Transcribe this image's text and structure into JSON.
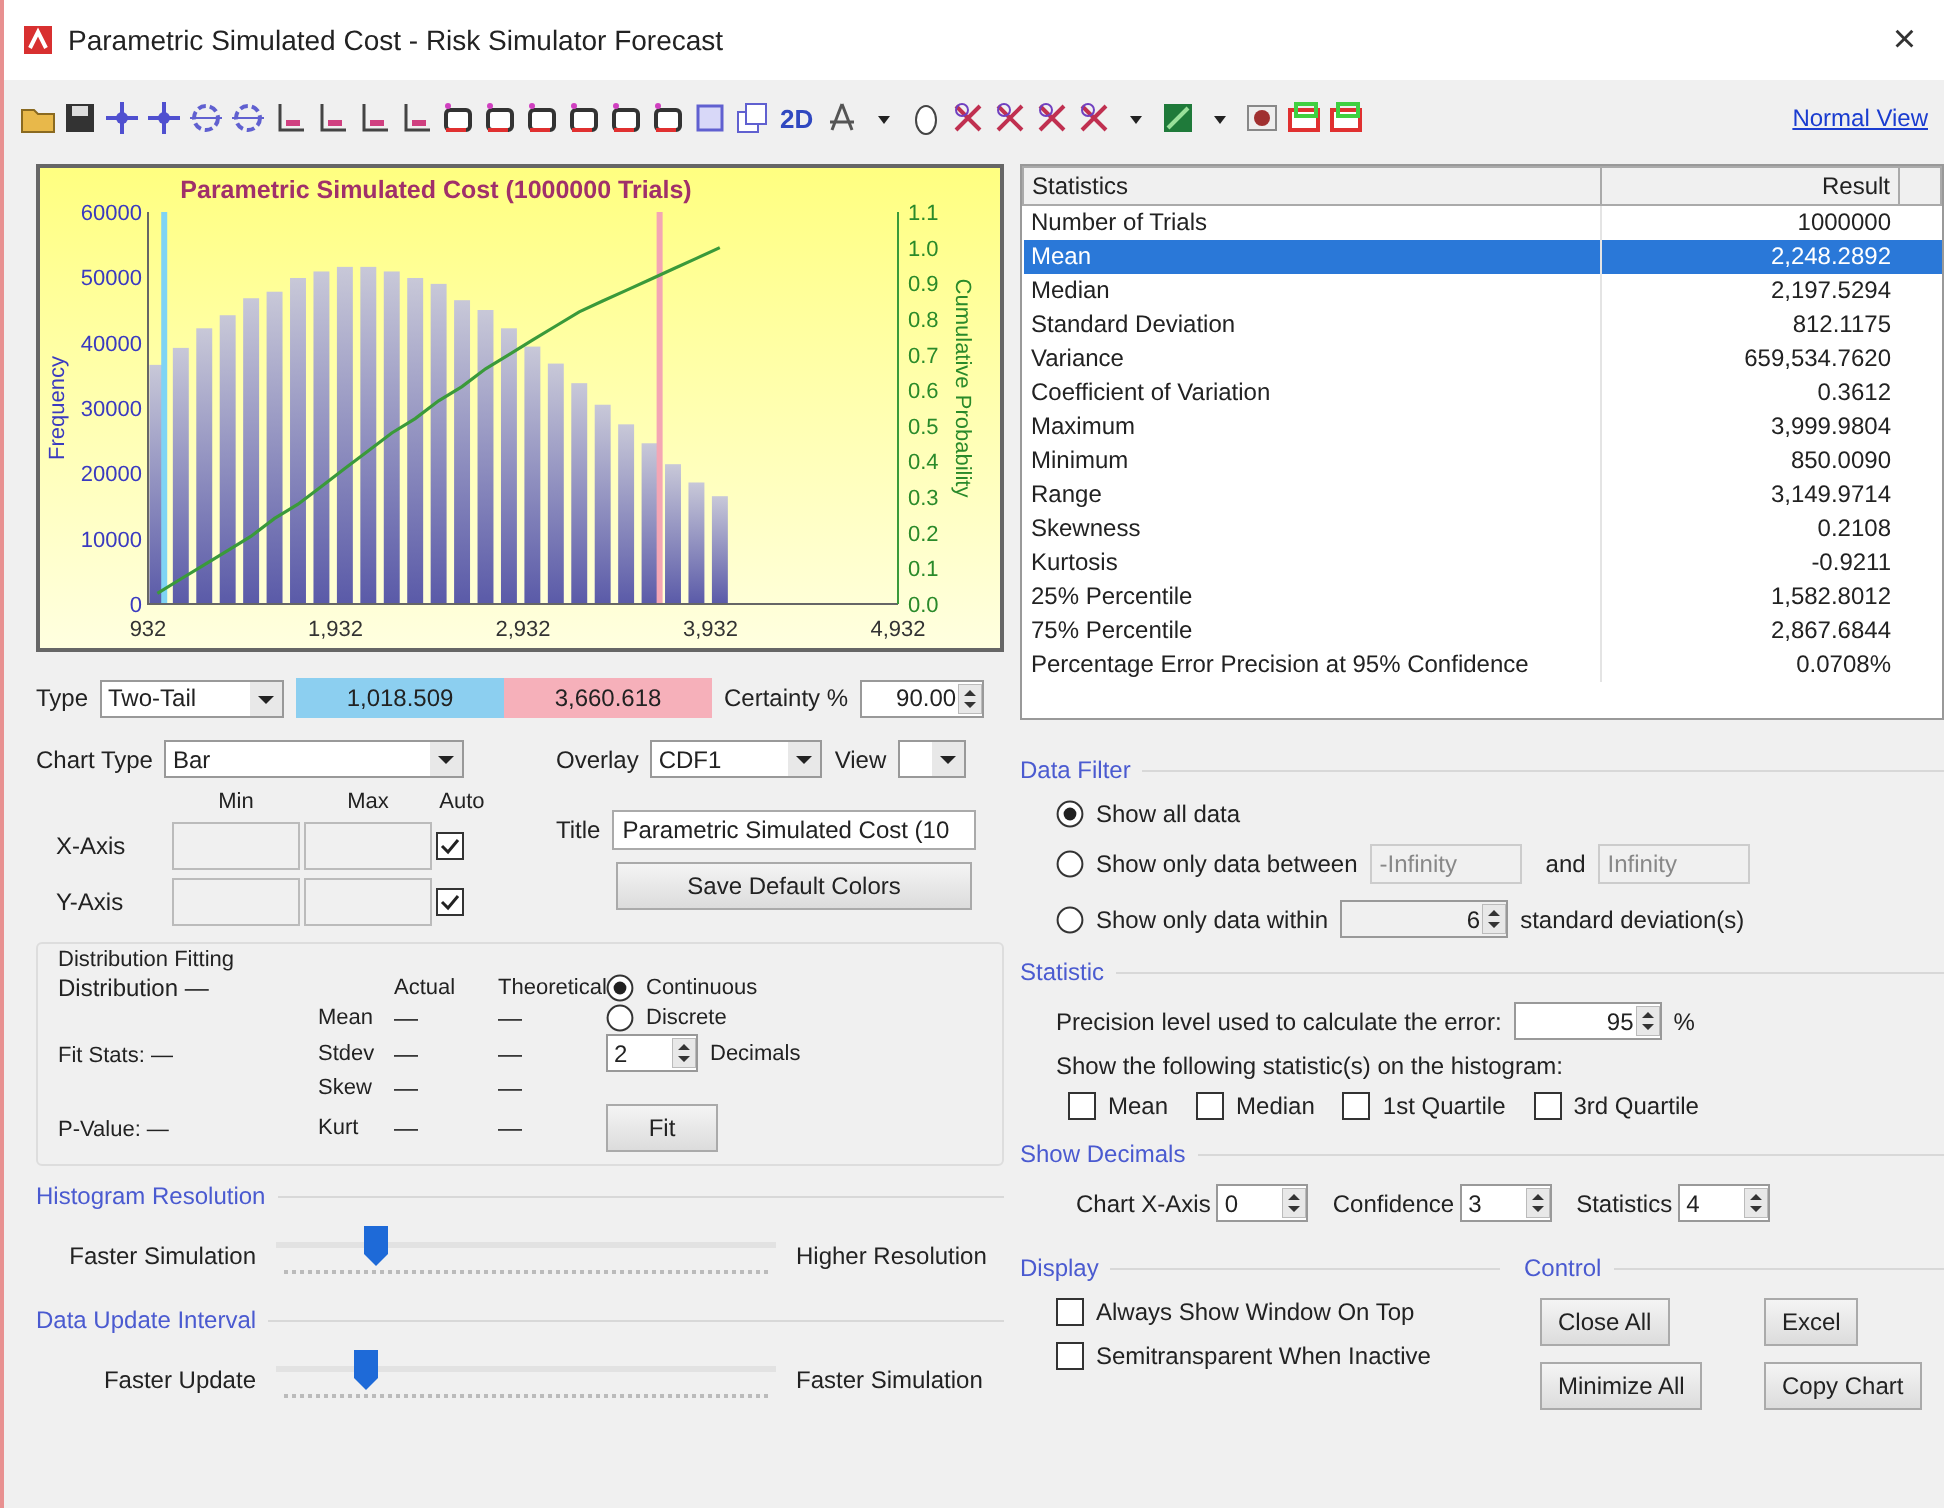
{
  "window": {
    "title": "Parametric Simulated Cost - Risk Simulator Forecast",
    "close": "×"
  },
  "toolbar": {
    "label_2d": "2D",
    "link": "Normal View"
  },
  "chart": {
    "chart_data": {
      "type": "bar",
      "title": "Parametric Simulated Cost (1000000 Trials)",
      "ylabel": "Frequency",
      "x": [
        982,
        1107,
        1232,
        1357,
        1482,
        1607,
        1732,
        1857,
        1982,
        2107,
        2232,
        2357,
        2482,
        2607,
        2732,
        2857,
        2982,
        3107,
        3232,
        3357,
        3482,
        3607,
        3732,
        3857,
        3982
      ],
      "series": [
        {
          "color": "#5a5aa8",
          "values": [
            36600,
            39200,
            42200,
            44200,
            46800,
            47800,
            49900,
            50900,
            51600,
            51600,
            50900,
            49900,
            49000,
            46500,
            45000,
            42200,
            39400,
            36800,
            33800,
            30500,
            27500,
            24600,
            21400,
            18600,
            16500
          ]
        }
      ],
      "xlim": [
        932,
        4932
      ],
      "ylim": [
        0,
        60000
      ],
      "xticks": [
        {
          "value": 932,
          "label": "932"
        },
        {
          "value": 1932,
          "label": "1,932"
        },
        {
          "value": 2932,
          "label": "2,932"
        },
        {
          "value": 3932,
          "label": "3,932"
        },
        {
          "value": 4932,
          "label": "4,932"
        }
      ],
      "yticks": [
        0,
        10000,
        20000,
        30000,
        40000,
        50000,
        60000
      ],
      "ref_lines": [
        {
          "axis": "x",
          "value": 1018.509,
          "color": "#7fd4f4"
        },
        {
          "axis": "x",
          "value": 3660.618,
          "color": "#f4a6b4"
        }
      ]
    },
    "cdf_overlay": {
      "chart_data": {
        "type": "line",
        "ylabel": "Cumulative Probability",
        "x": [
          982,
          1107,
          1232,
          1357,
          1482,
          1607,
          1732,
          1857,
          1982,
          2107,
          2232,
          2357,
          2482,
          2607,
          2732,
          2857,
          2982,
          3107,
          3232,
          3357,
          3482,
          3607,
          3732,
          3857,
          3982
        ],
        "series": [
          {
            "color": "#3a9a3a",
            "values": [
              0.03,
              0.07,
              0.11,
              0.15,
              0.19,
              0.24,
              0.28,
              0.33,
              0.38,
              0.43,
              0.48,
              0.52,
              0.57,
              0.61,
              0.66,
              0.7,
              0.74,
              0.78,
              0.82,
              0.85,
              0.88,
              0.91,
              0.94,
              0.97,
              1.0
            ]
          }
        ],
        "xlim": [
          932,
          4932
        ],
        "ylim": [
          0,
          1.1
        ],
        "yticks": [
          {
            "value": 1.1,
            "label": "1.1"
          },
          {
            "value": 1.0,
            "label": "1.0"
          },
          {
            "value": 0.9,
            "label": "0.9"
          },
          {
            "value": 0.8,
            "label": "0.8"
          },
          {
            "value": 0.7,
            "label": "0.7"
          },
          {
            "value": 0.6,
            "label": "0.6"
          },
          {
            "value": 0.5,
            "label": "0.5"
          },
          {
            "value": 0.4,
            "label": "0.4"
          },
          {
            "value": 0.3,
            "label": "0.3"
          },
          {
            "value": 0.2,
            "label": "0.2"
          },
          {
            "value": 0.1,
            "label": "0.1"
          },
          {
            "value": 0,
            "label": "0.0"
          }
        ]
      }
    }
  },
  "certainty": {
    "type_label": "Type",
    "type_value": "Two-Tail",
    "lower": "1,018.509",
    "upper": "3,660.618",
    "label": "Certainty %",
    "value": "90.00"
  },
  "chart_settings": {
    "chart_type_label": "Chart Type",
    "chart_type": "Bar",
    "overlay_label": "Overlay",
    "overlay": "CDF1",
    "view_label": "View",
    "axis_headers": [
      "Min",
      "Max",
      "Auto"
    ],
    "axes": [
      {
        "label": "X-Axis",
        "auto": true
      },
      {
        "label": "Y-Axis",
        "auto": true
      }
    ],
    "title_label": "Title",
    "title_value": "Parametric Simulated Cost (10",
    "save_button": "Save Default Colors"
  },
  "distribution_fitting": {
    "title": "Distribution Fitting",
    "info": [
      "Distribution —",
      "Fit Stats: —",
      "P-Value: —"
    ],
    "headers": [
      "Actual",
      "Theoretical"
    ],
    "rows": [
      {
        "label": "Mean",
        "actual": "—",
        "theoretical": "—"
      },
      {
        "label": "Stdev",
        "actual": "—",
        "theoretical": "—"
      },
      {
        "label": "Skew",
        "actual": "—",
        "theoretical": "—"
      },
      {
        "label": "Kurt",
        "actual": "—",
        "theoretical": "—"
      }
    ],
    "modes": [
      {
        "label": "Continuous",
        "selected": true
      },
      {
        "label": "Discrete",
        "selected": false
      }
    ],
    "decimals": "2",
    "decimals_label": "Decimals",
    "fit_button": "Fit"
  },
  "sliders": [
    {
      "title": "Histogram Resolution",
      "left": "Faster Simulation",
      "right": "Higher Resolution",
      "level": 0.2
    },
    {
      "title": "Data Update Interval",
      "left": "Faster Update",
      "right": "Faster Simulation",
      "level": 0.18
    }
  ],
  "statistics_table": {
    "columns": [
      "Statistics",
      "Result"
    ],
    "rows": [
      {
        "label": "Number of Trials",
        "value": "1000000",
        "selected": false
      },
      {
        "label": "Mean",
        "value": "2,248.2892",
        "selected": true
      },
      {
        "label": "Median",
        "value": "2,197.5294",
        "selected": false
      },
      {
        "label": "Standard Deviation",
        "value": "812.1175",
        "selected": false
      },
      {
        "label": "Variance",
        "value": "659,534.7620",
        "selected": false
      },
      {
        "label": "Coefficient of Variation",
        "value": "0.3612",
        "selected": false
      },
      {
        "label": "Maximum",
        "value": "3,999.9804",
        "selected": false
      },
      {
        "label": "Minimum",
        "value": "850.0090",
        "selected": false
      },
      {
        "label": "Range",
        "value": "3,149.9714",
        "selected": false
      },
      {
        "label": "Skewness",
        "value": "0.2108",
        "selected": false
      },
      {
        "label": "Kurtosis",
        "value": "-0.9211",
        "selected": false
      },
      {
        "label": "25% Percentile",
        "value": "1,582.8012",
        "selected": false
      },
      {
        "label": "75% Percentile",
        "value": "2,867.6844",
        "selected": false
      },
      {
        "label": "Percentage Error Precision at 95% Confidence",
        "value": "0.0708%",
        "selected": false
      }
    ]
  },
  "data_filter": {
    "title": "Data Filter",
    "options": [
      {
        "kind": "plain",
        "label": "Show all data",
        "selected": true
      },
      {
        "kind": "between",
        "label": "Show only data between",
        "from": "-Infinity",
        "and": "and",
        "to": "Infinity",
        "selected": false
      },
      {
        "kind": "within",
        "label": "Show only data within",
        "value": "6",
        "suffix": "standard deviation(s)",
        "selected": false
      }
    ]
  },
  "statistic": {
    "title": "Statistic",
    "precision_label": "Precision level used to calculate the error:",
    "precision": "95",
    "unit": "%",
    "show_label": "Show the following statistic(s) on the histogram:",
    "checks": [
      {
        "label": "Mean",
        "checked": false
      },
      {
        "label": "Median",
        "checked": false
      },
      {
        "label": "1st Quartile",
        "checked": false
      },
      {
        "label": "3rd Quartile",
        "checked": false
      }
    ]
  },
  "show_decimals": {
    "title": "Show Decimals",
    "fields": [
      {
        "label": "Chart X-Axis",
        "value": "0"
      },
      {
        "label": "Confidence",
        "value": "3"
      },
      {
        "label": "Statistics",
        "value": "4"
      }
    ]
  },
  "display": {
    "title": "Display",
    "options": [
      {
        "label": "Always Show Window On Top",
        "checked": false
      },
      {
        "label": "Semitransparent When Inactive",
        "checked": false
      }
    ]
  },
  "control": {
    "title": "Control",
    "buttons": [
      "Close All",
      "Excel",
      "Minimize All",
      "Copy Chart"
    ]
  }
}
